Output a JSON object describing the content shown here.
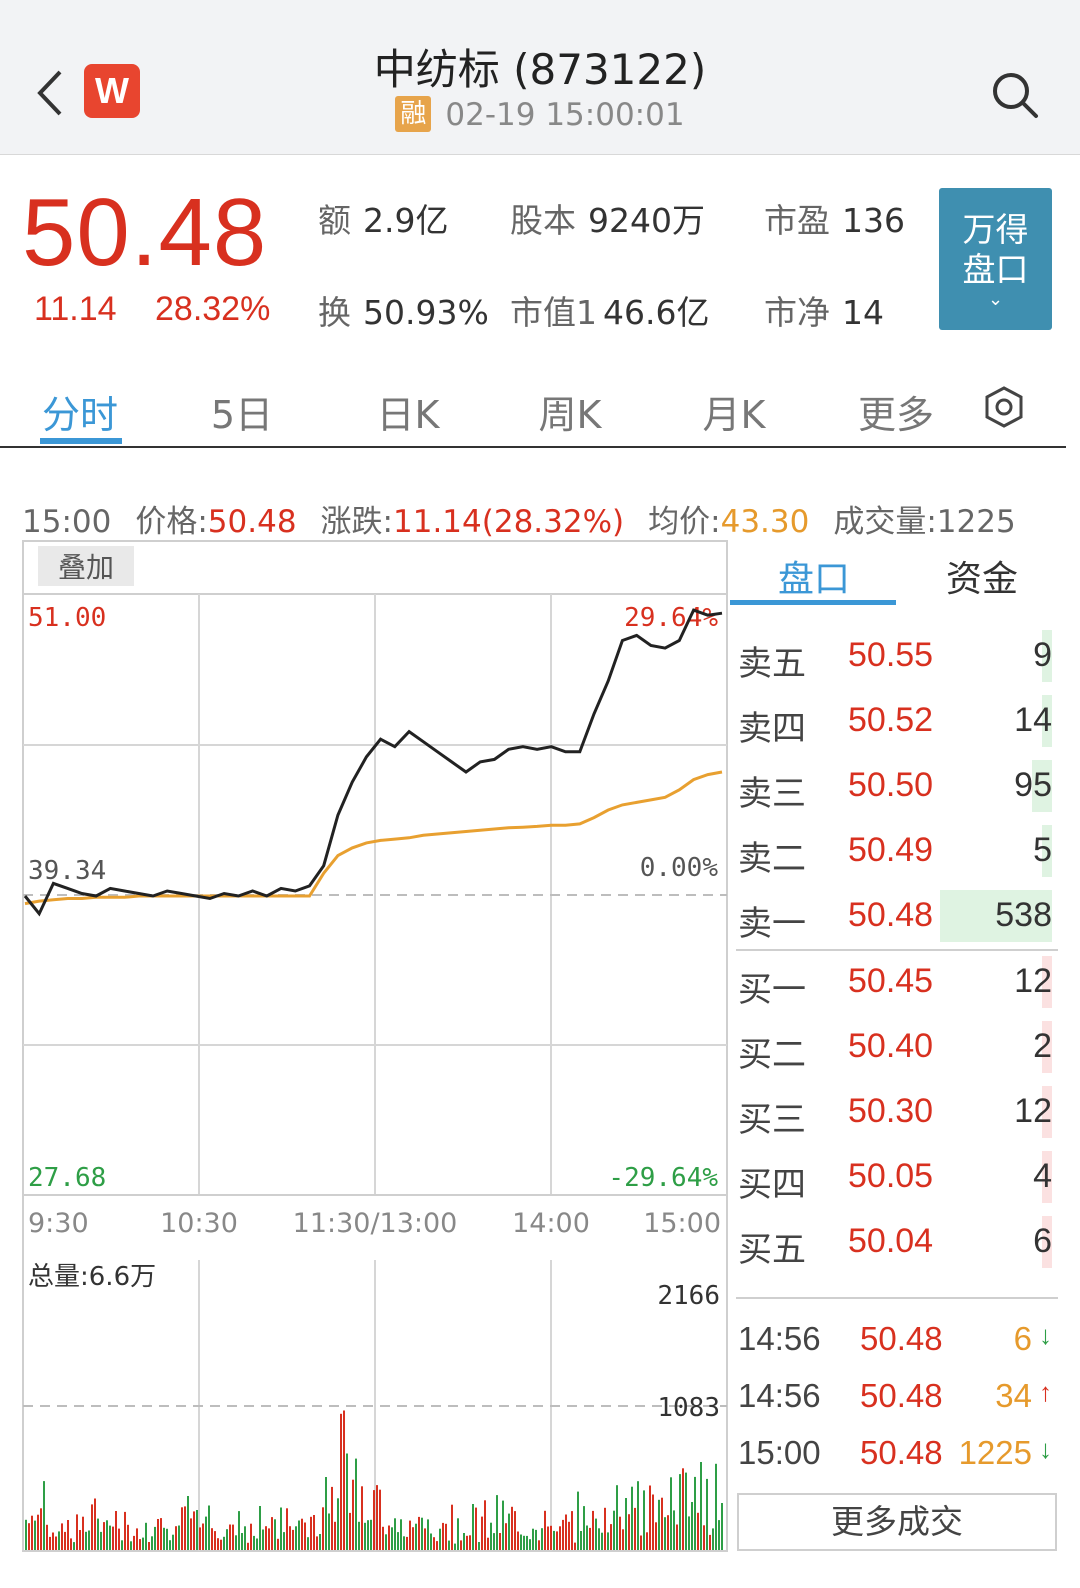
{
  "header": {
    "title": "中纺标 (873122)",
    "rong_tag": "融",
    "datetime": "02-19 15:00:01",
    "logo_letter": "W"
  },
  "quote": {
    "price": "50.48",
    "change": "11.14",
    "change_pct": "28.32%",
    "stats": [
      {
        "label": "额",
        "value": "2.9亿"
      },
      {
        "label": "股本",
        "value": "9240万"
      },
      {
        "label": "市盈",
        "value": "136"
      },
      {
        "label": "换",
        "value": "50.93%"
      },
      {
        "label": "市值1",
        "value": "46.6亿"
      },
      {
        "label": "市净",
        "value": "14"
      }
    ],
    "wind_button": [
      "万得",
      "盘口",
      "⌄"
    ]
  },
  "tabs": [
    "分时",
    "5日",
    "日K",
    "周K",
    "月K",
    "更多"
  ],
  "active_tab": "分时",
  "infoline": {
    "time": "15:00",
    "price_label": "价格:",
    "price": "50.48",
    "change_label": "涨跌:",
    "change": "11.14(28.32%)",
    "avg_label": "均价:",
    "avg": "43.30",
    "vol_label": "成交量:",
    "vol": "1225"
  },
  "chart": {
    "overlay_button": "叠加",
    "y_top": "51.00",
    "y_mid": "39.34",
    "y_bottom": "27.68",
    "pct_top": "29.64%",
    "pct_mid": "0.00%",
    "pct_bottom": "-29.64%",
    "time_labels": [
      "9:30",
      "10:30",
      "11:30/13:00",
      "14:00",
      "15:00"
    ],
    "total_volume": "总量:6.6万",
    "vol_top": "2166",
    "vol_mid": "1083",
    "colors": {
      "price_line": "#222222",
      "avg_line": "#e8a030",
      "up": "#d8301f",
      "down": "#2e9e46"
    }
  },
  "chart_data": {
    "type": "line",
    "series": [
      {
        "values": [
          39.3,
          38.6,
          39.8,
          39.6,
          39.4,
          39.3,
          39.6,
          39.5,
          39.4,
          39.3,
          39.5,
          39.4,
          39.3,
          39.2,
          39.4,
          39.3,
          39.5,
          39.3,
          39.6,
          39.5,
          39.7,
          40.5,
          42.5,
          43.8,
          44.8,
          45.5,
          45.2,
          45.8,
          45.4,
          45.0,
          44.6,
          44.2,
          44.6,
          44.7,
          45.1,
          45.2,
          45.1,
          45.2,
          45.0,
          45.0,
          46.5,
          47.8,
          49.4,
          49.6,
          49.2,
          49.1,
          49.4,
          50.6,
          50.4,
          50.48
        ]
      },
      {
        "values": [
          39.0,
          39.1,
          39.15,
          39.2,
          39.2,
          39.25,
          39.25,
          39.25,
          39.3,
          39.3,
          39.3,
          39.3,
          39.3,
          39.3,
          39.3,
          39.3,
          39.3,
          39.3,
          39.3,
          39.3,
          39.3,
          40.2,
          40.9,
          41.2,
          41.4,
          41.5,
          41.55,
          41.6,
          41.7,
          41.75,
          41.8,
          41.85,
          41.9,
          41.95,
          42.0,
          42.02,
          42.05,
          42.1,
          42.1,
          42.15,
          42.4,
          42.7,
          42.9,
          43.0,
          43.1,
          43.2,
          43.5,
          43.9,
          44.1,
          44.2
        ]
      }
    ],
    "ylim": [
      27.68,
      51.0
    ]
  },
  "orderbook": {
    "tabs": [
      "盘口",
      "资金"
    ],
    "asks": [
      {
        "label": "卖五",
        "price": "50.55",
        "qty": "9",
        "share": 0.02
      },
      {
        "label": "卖四",
        "price": "50.52",
        "qty": "14",
        "share": 0.03
      },
      {
        "label": "卖三",
        "price": "50.50",
        "qty": "95",
        "share": 0.18
      },
      {
        "label": "卖二",
        "price": "50.49",
        "qty": "5",
        "share": 0.01
      },
      {
        "label": "卖一",
        "price": "50.48",
        "qty": "538",
        "share": 1.0
      }
    ],
    "bids": [
      {
        "label": "买一",
        "price": "50.45",
        "qty": "12",
        "share": 0.03
      },
      {
        "label": "买二",
        "price": "50.40",
        "qty": "2",
        "share": 0.01
      },
      {
        "label": "买三",
        "price": "50.30",
        "qty": "12",
        "share": 0.03
      },
      {
        "label": "买四",
        "price": "50.05",
        "qty": "4",
        "share": 0.01
      },
      {
        "label": "买五",
        "price": "50.04",
        "qty": "6",
        "share": 0.01
      }
    ],
    "trades": [
      {
        "time": "14:56",
        "price": "50.48",
        "vol": "6",
        "dir": "↓",
        "color": "#2e9e46"
      },
      {
        "time": "14:56",
        "price": "50.48",
        "vol": "34",
        "dir": "↑",
        "color": "#d8301f"
      },
      {
        "time": "15:00",
        "price": "50.48",
        "vol": "1225",
        "dir": "↓",
        "color": "#2e9e46"
      }
    ],
    "more_button": "更多成交"
  }
}
